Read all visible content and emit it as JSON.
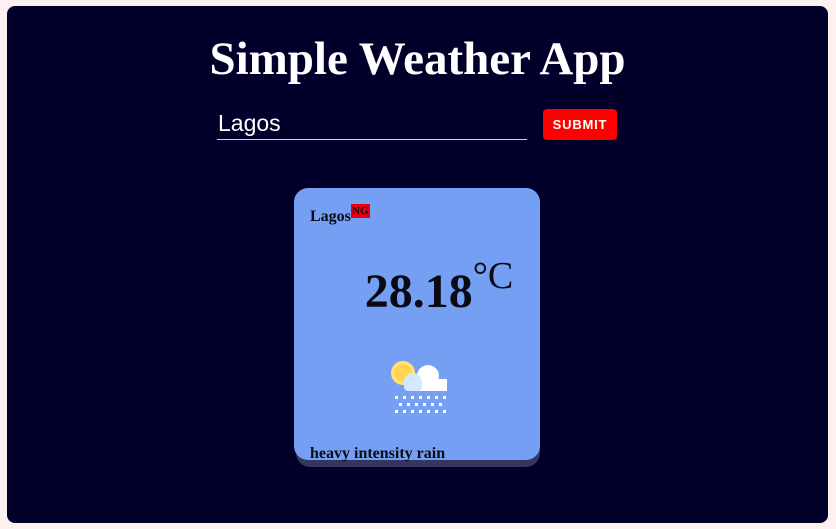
{
  "app": {
    "title": "Simple Weather App"
  },
  "search": {
    "value": "Lagos",
    "submit_label": "SUBMIT"
  },
  "weather": {
    "city": "Lagos",
    "country": "NG",
    "temperature": "28.18",
    "unit": "°C",
    "description": "heavy intensity rain",
    "icon": "sun-cloud-rain-icon"
  },
  "colors": {
    "background": "#02002a",
    "card": "#759ff3",
    "accent": "#ff0000",
    "country_badge": "#e0000f"
  }
}
